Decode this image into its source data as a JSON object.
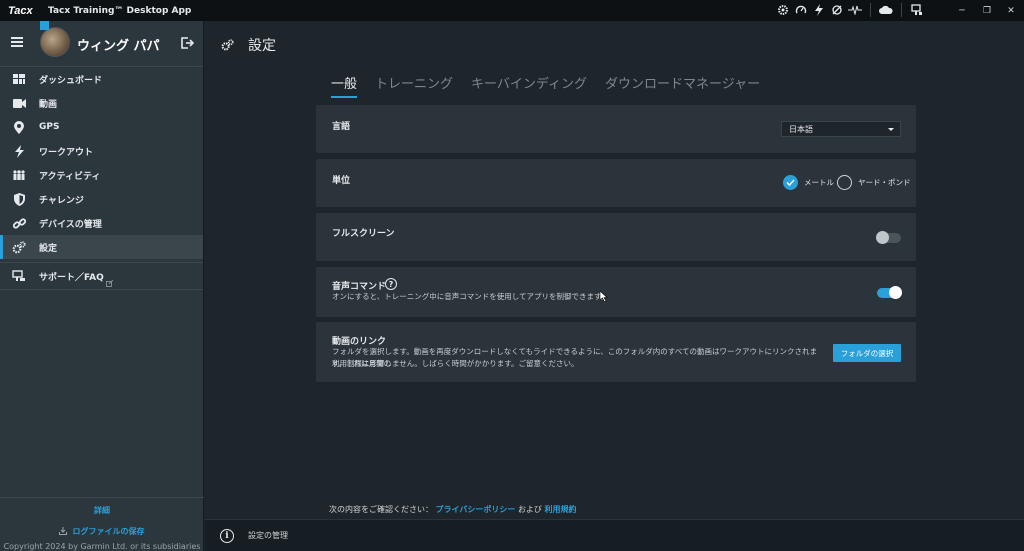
{
  "titlebar": {
    "logo": "Tacx",
    "title": "Tacx Training™ Desktop App",
    "icons": [
      "settings-gear-icon",
      "speedometer-icon",
      "power-bolt-icon",
      "cadence-icon",
      "heartrate-icon",
      "cloud-icon",
      "device-icon"
    ],
    "window_controls": [
      "minimize",
      "restore",
      "close"
    ]
  },
  "profile": {
    "name": "ウィング パパ"
  },
  "sidebar": {
    "items": [
      {
        "label": "ダッシュボード",
        "icon": "dashboard-icon"
      },
      {
        "label": "動画",
        "icon": "video-icon"
      },
      {
        "label": "GPS",
        "icon": "map-pin-icon"
      },
      {
        "label": "ワークアウト",
        "icon": "bolt-icon"
      },
      {
        "label": "アクティビティ",
        "icon": "people-icon"
      },
      {
        "label": "チャレンジ",
        "icon": "shield-icon"
      },
      {
        "label": "デバイスの管理",
        "icon": "link-icon"
      },
      {
        "label": "設定",
        "icon": "gears-icon",
        "active": true
      }
    ],
    "support": {
      "label": "サポート／FAQ",
      "icon": "support-icon"
    },
    "footer": {
      "details": "詳細",
      "save_log": "ログファイルの保存",
      "copyright": "Copyright 2024 by Garmin Ltd. or its subsidiaries"
    }
  },
  "main": {
    "page_title": "設定",
    "tabs": [
      {
        "label": "一般",
        "active": true
      },
      {
        "label": "トレーニング"
      },
      {
        "label": "キーバインディング"
      },
      {
        "label": "ダウンロードマネージャー"
      }
    ],
    "language": {
      "title": "言語",
      "selected": "日本語"
    },
    "units": {
      "title": "単位",
      "options": [
        {
          "label": "メートル",
          "selected": true
        },
        {
          "label": "ヤード・ポンド",
          "selected": false
        }
      ]
    },
    "fullscreen": {
      "title": "フルスクリーン",
      "enabled": false
    },
    "voice": {
      "title": "音声コマンド",
      "description": "オンにすると、トレーニング中に音声コマンドを使用してアプリを制御できます。",
      "enabled": true
    },
    "video_link": {
      "title": "動画のリンク",
      "description_1": "フォルダを選択します。動画を再度ダウンロードしなくてもライドできるように、このフォルダ内のすべての動画はワークアウトにリンクされます。これは月間の",
      "description_2": "利用制限に影響しません。しばらく時間がかかります。ご留意ください。",
      "button": "フォルダの選択"
    },
    "legal": {
      "prefix": "次の内容をご確認ください：",
      "privacy": "プライバシーポリシー",
      "and": "および",
      "terms": "利用規約"
    }
  },
  "status_bar": {
    "text": "設定の管理"
  },
  "colors": {
    "accent": "#2aa0da",
    "background": "#1e262c",
    "sidebar": "#2c363d",
    "card": "#2b343b"
  }
}
